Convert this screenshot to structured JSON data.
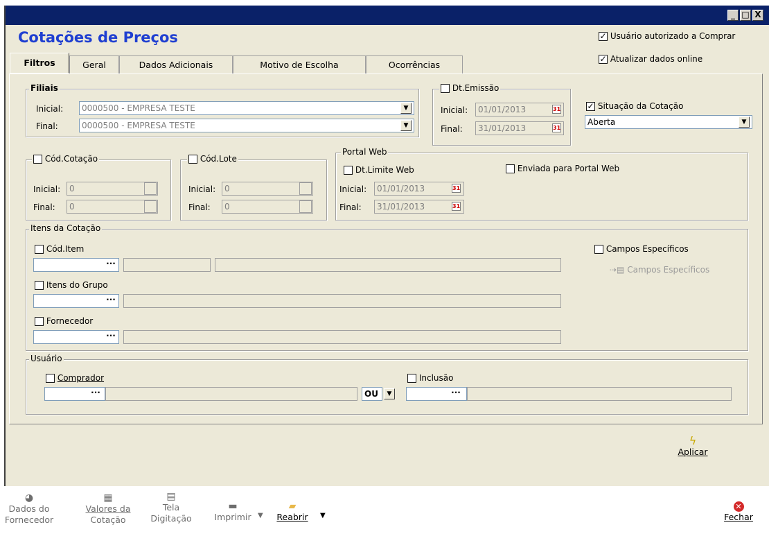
{
  "window": {
    "title": "Cotações de Preços",
    "controls": [
      "_",
      "□",
      "X"
    ]
  },
  "options": {
    "usuario_autorizado": {
      "label": "Usuário autorizado a Comprar",
      "checked": true
    },
    "atualizar_online": {
      "label": "Atualizar dados online",
      "checked": true
    }
  },
  "tabs": [
    {
      "label": "Filtros",
      "active": true
    },
    {
      "label": "Geral"
    },
    {
      "label": "Dados Adicionais"
    },
    {
      "label": "Motivo de Escolha"
    },
    {
      "label": "Ocorrências"
    }
  ],
  "filiais": {
    "legend": "Filiais",
    "inicial_label": "Inicial:",
    "inicial_value": "0000500 - EMPRESA TESTE",
    "final_label": "Final:",
    "final_value": "0000500 - EMPRESA TESTE"
  },
  "dt_emissao": {
    "legend": "Dt.Emissão",
    "inicial_label": "Inicial:",
    "inicial_value": "01/01/2013",
    "final_label": "Final:",
    "final_value": "31/01/2013"
  },
  "situacao": {
    "label": "Situação da Cotação",
    "checked": true,
    "value": "Aberta"
  },
  "cod_cotacao": {
    "legend": "Cód.Cotação",
    "inicial_label": "Inicial:",
    "inicial_value": "0",
    "final_label": "Final:",
    "final_value": "0"
  },
  "cod_lote": {
    "legend": "Cód.Lote",
    "inicial_label": "Inicial:",
    "inicial_value": "0",
    "final_label": "Final:",
    "final_value": "0"
  },
  "portal_web": {
    "legend": "Portal Web",
    "dt_limite_label": "Dt.Limite Web",
    "enviada_label": "Enviada para Portal Web",
    "inicial_label": "Inicial:",
    "inicial_value": "01/01/2013",
    "final_label": "Final:",
    "final_value": "31/01/2013"
  },
  "itens": {
    "legend": "Itens da Cotação",
    "cod_item_label": "Cód.Item",
    "itens_grupo_label": "Itens do Grupo",
    "fornecedor_label": "Fornecedor",
    "campos_label": "Campos Específicos",
    "campos_button": "Campos Específicos"
  },
  "usuario": {
    "legend": "Usuário",
    "comprador_label": "Comprador",
    "inclusao_label": "Inclusão",
    "ou_value": "OU"
  },
  "aplicar": "Aplicar",
  "toolbar": {
    "dados_fornecedor": [
      "Dados do",
      "Fornecedor"
    ],
    "valores_cotacao": [
      "Valores da",
      "Cotação"
    ],
    "tela_digitacao": [
      "Tela",
      "Digitação"
    ],
    "imprimir": "Imprimir",
    "reabrir": "Reabrir",
    "fechar": "Fechar"
  },
  "colors": {
    "titlebar": "#0a2168",
    "title_text": "#1f3fd1",
    "window_bg": "#ece9d8"
  }
}
